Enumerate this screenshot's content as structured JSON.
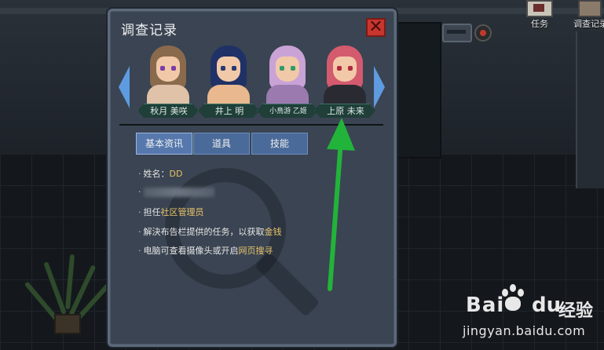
{
  "hud": {
    "task_label": "任务",
    "record_label": "调查记录"
  },
  "dialog": {
    "title": "调查记录",
    "close_glyph": "✕",
    "characters": [
      {
        "name": "秋月 美咲"
      },
      {
        "name": "井上 明"
      },
      {
        "name": "小鳥游 乙姬"
      },
      {
        "name": "上原 未来"
      }
    ],
    "tabs": [
      {
        "label": "基本资讯",
        "active": true
      },
      {
        "label": "道具",
        "active": false
      },
      {
        "label": "技能",
        "active": false
      }
    ],
    "info": {
      "row1_prefix": "姓名：",
      "row1_value": "DD",
      "row3_prefix": "担任",
      "row3_value": "社区管理员",
      "row4_prefix": "解決布告栏提供的任务，以获取",
      "row4_value": "金钱",
      "row5_prefix": "电脑可查看摄像头或开启",
      "row5_value": "网页搜寻"
    }
  },
  "watermark": {
    "logo": "Bai",
    "logo_tail": "du",
    "brand": "经验",
    "url": "jingyan.baidu.com"
  },
  "colors": {
    "highlight": "#e9c46a",
    "annotation_arrow": "#22b33a",
    "tab_active": "#5678ad"
  }
}
